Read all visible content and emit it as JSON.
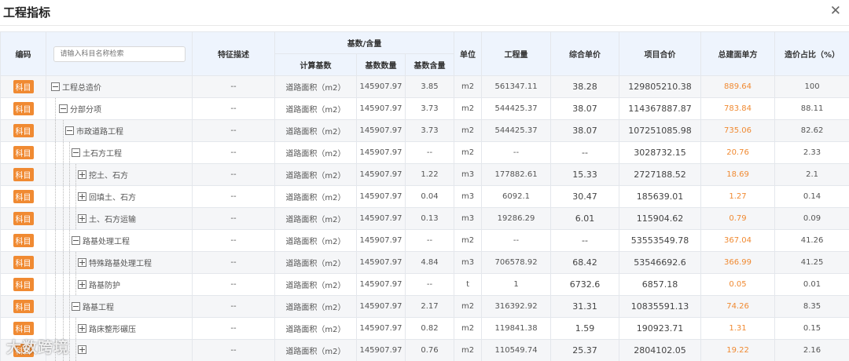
{
  "window": {
    "title": "工程指标"
  },
  "search": {
    "placeholder": "请输入科目名称检索"
  },
  "columns": {
    "code": "编码",
    "feature": "特征描述",
    "basis_group": "基数/含量",
    "calc_basis": "计算基数",
    "basis_qty": "基数数量",
    "basis_content": "基数含量",
    "unit": "单位",
    "quantity": "工程量",
    "unit_price": "综合单价",
    "total": "项目合价",
    "per_area": "总建面单方",
    "ratio": "造价占比（%）"
  },
  "rows": [
    {
      "badge": "科目",
      "name": "工程总造价",
      "level": 0,
      "toggle": "minus",
      "feature": "--",
      "calc_basis": "道路面积（m2）",
      "basis_qty": "145907.97",
      "basis_content": "3.85",
      "unit": "m2",
      "quantity": "561347.11",
      "unit_price": "38.28",
      "total": "129805210.38",
      "per_area": "889.64",
      "ratio": "100"
    },
    {
      "badge": "科目",
      "name": "分部分项",
      "level": 1,
      "toggle": "minus",
      "feature": "--",
      "calc_basis": "道路面积（m2）",
      "basis_qty": "145907.97",
      "basis_content": "3.73",
      "unit": "m2",
      "quantity": "544425.37",
      "unit_price": "38.07",
      "total": "114367887.87",
      "per_area": "783.84",
      "ratio": "88.11"
    },
    {
      "badge": "科目",
      "name": "市政道路工程",
      "level": 2,
      "toggle": "minus",
      "feature": "--",
      "calc_basis": "道路面积（m2）",
      "basis_qty": "145907.97",
      "basis_content": "3.73",
      "unit": "m2",
      "quantity": "544425.37",
      "unit_price": "38.07",
      "total": "107251085.98",
      "per_area": "735.06",
      "ratio": "82.62"
    },
    {
      "badge": "科目",
      "name": "土石方工程",
      "level": 3,
      "toggle": "minus",
      "feature": "--",
      "calc_basis": "道路面积（m2）",
      "basis_qty": "145907.97",
      "basis_content": "--",
      "unit": "m2",
      "quantity": "--",
      "unit_price": "--",
      "total": "3028732.15",
      "per_area": "20.76",
      "ratio": "2.33"
    },
    {
      "badge": "科目",
      "name": "挖土、石方",
      "level": 4,
      "toggle": "plus",
      "feature": "--",
      "calc_basis": "道路面积（m2）",
      "basis_qty": "145907.97",
      "basis_content": "1.22",
      "unit": "m3",
      "quantity": "177882.61",
      "unit_price": "15.33",
      "total": "2727188.52",
      "per_area": "18.69",
      "ratio": "2.1"
    },
    {
      "badge": "科目",
      "name": "回填土、石方",
      "level": 4,
      "toggle": "plus",
      "feature": "--",
      "calc_basis": "道路面积（m2）",
      "basis_qty": "145907.97",
      "basis_content": "0.04",
      "unit": "m3",
      "quantity": "6092.1",
      "unit_price": "30.47",
      "total": "185639.01",
      "per_area": "1.27",
      "ratio": "0.14"
    },
    {
      "badge": "科目",
      "name": "土、石方运输",
      "level": 4,
      "toggle": "plus",
      "feature": "--",
      "calc_basis": "道路面积（m2）",
      "basis_qty": "145907.97",
      "basis_content": "0.13",
      "unit": "m3",
      "quantity": "19286.29",
      "unit_price": "6.01",
      "total": "115904.62",
      "per_area": "0.79",
      "ratio": "0.09"
    },
    {
      "badge": "科目",
      "name": "路基处理工程",
      "level": 3,
      "toggle": "minus",
      "feature": "--",
      "calc_basis": "道路面积（m2）",
      "basis_qty": "145907.97",
      "basis_content": "--",
      "unit": "m2",
      "quantity": "--",
      "unit_price": "--",
      "total": "53553549.78",
      "per_area": "367.04",
      "ratio": "41.26"
    },
    {
      "badge": "科目",
      "name": "特殊路基处理工程",
      "level": 4,
      "toggle": "plus",
      "feature": "--",
      "calc_basis": "道路面积（m2）",
      "basis_qty": "145907.97",
      "basis_content": "4.84",
      "unit": "m3",
      "quantity": "706578.92",
      "unit_price": "68.42",
      "total": "53546692.6",
      "per_area": "366.99",
      "ratio": "41.25"
    },
    {
      "badge": "科目",
      "name": "路基防护",
      "level": 4,
      "toggle": "plus",
      "feature": "--",
      "calc_basis": "道路面积（m2）",
      "basis_qty": "145907.97",
      "basis_content": "--",
      "unit": "t",
      "quantity": "1",
      "unit_price": "6732.6",
      "total": "6857.18",
      "per_area": "0.05",
      "ratio": "0.01"
    },
    {
      "badge": "科目",
      "name": "路基工程",
      "level": 3,
      "toggle": "minus",
      "feature": "--",
      "calc_basis": "道路面积（m2）",
      "basis_qty": "145907.97",
      "basis_content": "2.17",
      "unit": "m2",
      "quantity": "316392.92",
      "unit_price": "31.31",
      "total": "10835591.13",
      "per_area": "74.26",
      "ratio": "8.35"
    },
    {
      "badge": "科目",
      "name": "路床整形碾压",
      "level": 4,
      "toggle": "plus",
      "feature": "--",
      "calc_basis": "道路面积（m2）",
      "basis_qty": "145907.97",
      "basis_content": "0.82",
      "unit": "m2",
      "quantity": "119841.38",
      "unit_price": "1.59",
      "total": "190923.71",
      "per_area": "1.31",
      "ratio": "0.15"
    },
    {
      "badge": "科目",
      "name": "",
      "level": 4,
      "toggle": "plus",
      "feature": "--",
      "calc_basis": "道路面积（m2）",
      "basis_qty": "145907.97",
      "basis_content": "0.76",
      "unit": "m2",
      "quantity": "110549.74",
      "unit_price": "25.37",
      "total": "2804102.05",
      "per_area": "19.22",
      "ratio": "2.16"
    }
  ],
  "watermark": {
    "text": "大数跨境"
  },
  "colors": {
    "accent": "#f08a32",
    "header_bg": "#eef4fd"
  }
}
